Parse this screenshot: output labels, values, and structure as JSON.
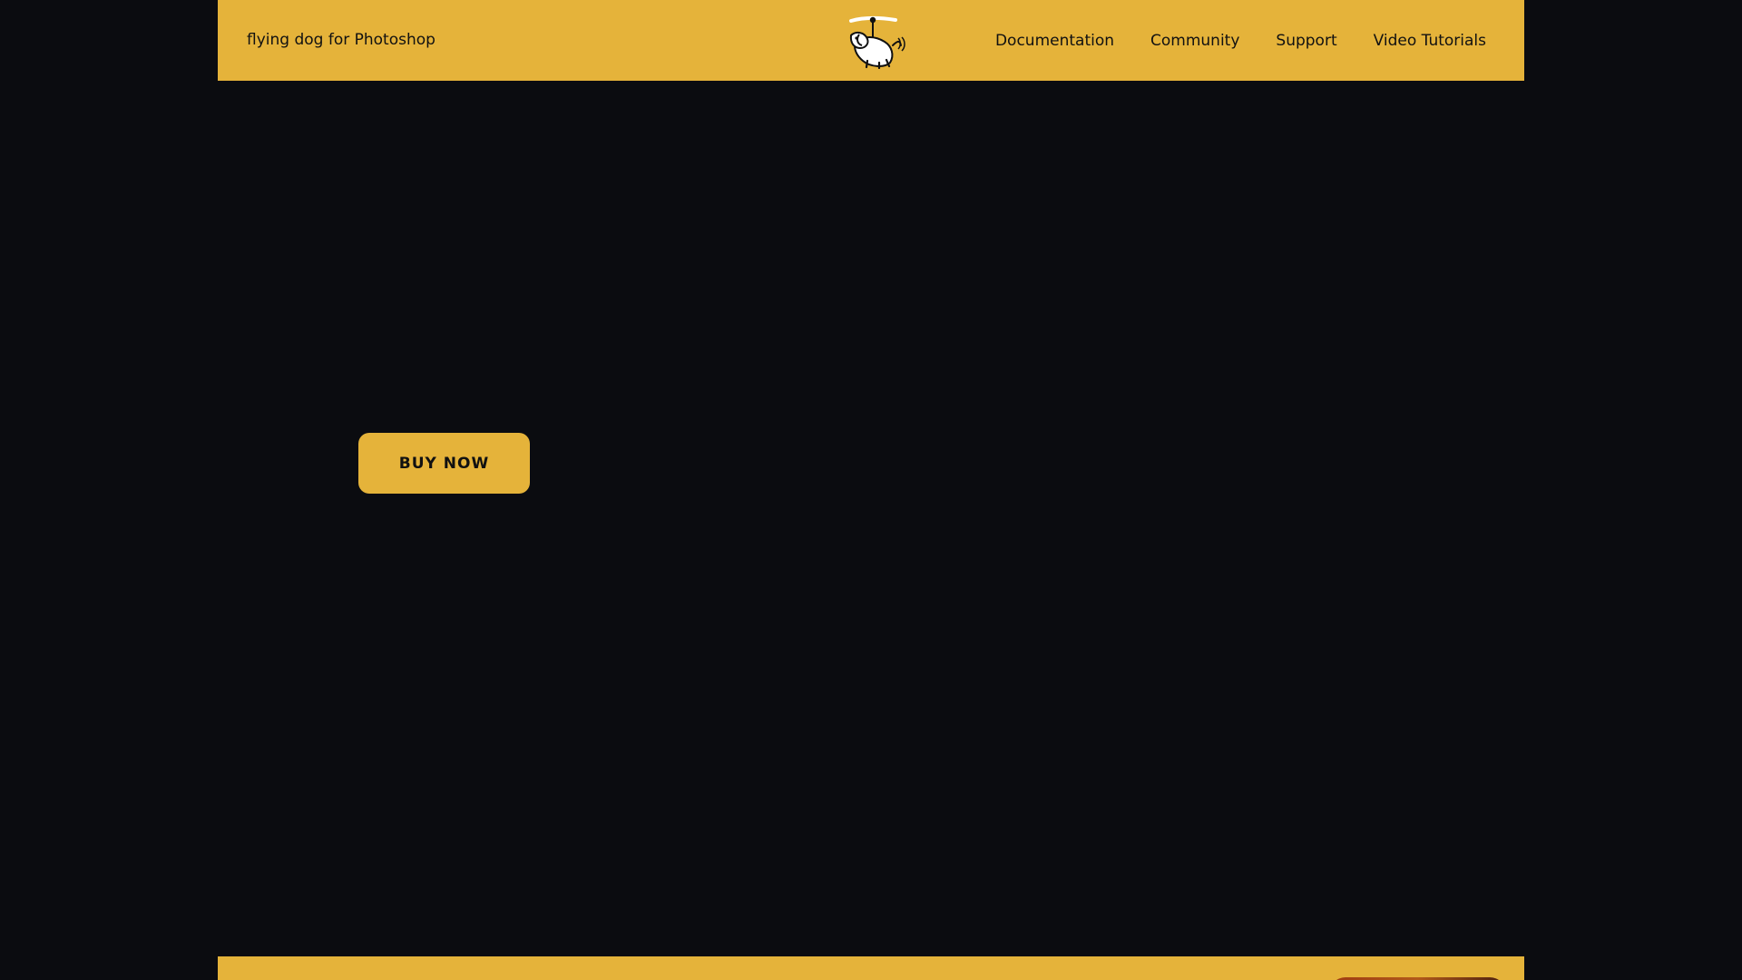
{
  "header": {
    "brand": "flying dog for Photoshop",
    "logo_icon": "flying-dog-logo",
    "nav": [
      {
        "label": "Documentation"
      },
      {
        "label": "Community"
      },
      {
        "label": "Support"
      },
      {
        "label": "Video Tutorials"
      }
    ]
  },
  "hero": {
    "cta_label": "BUY NOW"
  },
  "colors": {
    "accent": "#e5b33a",
    "background": "#0b0c10",
    "text_dark": "#111111"
  }
}
